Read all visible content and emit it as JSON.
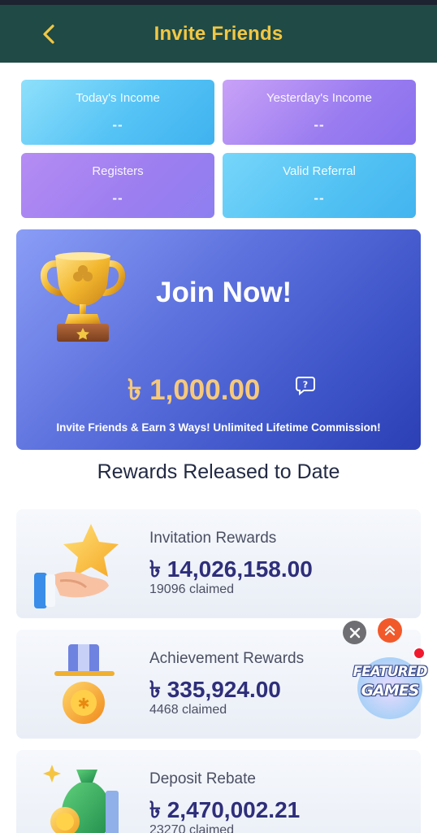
{
  "header": {
    "title": "Invite Friends"
  },
  "stats": [
    {
      "label": "Today's Income",
      "value": "--"
    },
    {
      "label": "Yesterday's Income",
      "value": "--"
    },
    {
      "label": "Registers",
      "value": "--"
    },
    {
      "label": "Valid Referral",
      "value": "--"
    }
  ],
  "banner": {
    "heading": "Join Now!",
    "amount": "৳ 1,000.00",
    "note": "Invite Friends & Earn 3 Ways! Unlimited Lifetime Commission!"
  },
  "section": {
    "title": "Rewards Released to Date"
  },
  "rewards": [
    {
      "title": "Invitation Rewards",
      "amount": "৳ 14,026,158.00",
      "claimed": "19096 claimed",
      "icon": "hand-star-icon"
    },
    {
      "title": "Achievement Rewards",
      "amount": "৳ 335,924.00",
      "claimed": "4468 claimed",
      "icon": "medal-icon"
    },
    {
      "title": "Deposit Rebate",
      "amount": "৳ 2,470,002.21",
      "claimed": "23270 claimed",
      "icon": "money-bag-icon"
    }
  ],
  "floating": {
    "featured_line1": "FEATURED",
    "featured_line2": "GAMES"
  },
  "colors": {
    "header_bg": "#1f4a45",
    "header_title": "#f2c744",
    "amount_gold": "#f6c97c",
    "reward_amount": "#2e2e7a",
    "badge_red": "#f0192e",
    "up_orange": "#f2592a"
  }
}
